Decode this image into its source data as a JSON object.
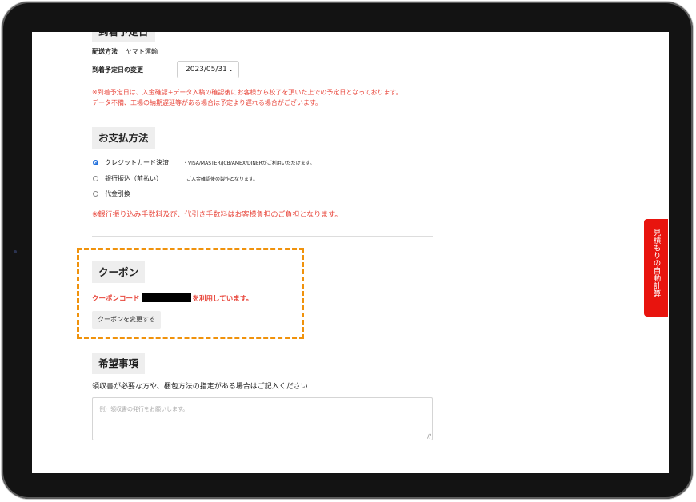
{
  "arrival": {
    "heading": "到着予定日",
    "shipping_label": "配送方法",
    "shipping_value": "ヤマト運輸",
    "date_label": "到着予定日の変更",
    "date_value": "2023/05/31",
    "note_line1": "※到着予定日は、入金確認+データ入稿の確認後にお客様から校了を頂いた上での予定日となっております。",
    "note_line2": "データ不備、工場の納期遅延等がある場合は予定より遅れる場合がございます。"
  },
  "payment": {
    "heading": "お支払方法",
    "options": [
      {
        "label": "クレジットカード決済",
        "note": "・VISA/MASTER/JCB/AMEX/DINERがご利用いただけます。",
        "checked": true
      },
      {
        "label": "銀行振込（前払い）",
        "note": "ご入金確認後の製作となります。",
        "checked": false
      },
      {
        "label": "代金引換",
        "note": "",
        "checked": false
      }
    ],
    "fee_note": "※銀行振り込み手数料及び、代引き手数料はお客様負担のご負担となります。"
  },
  "coupon": {
    "heading": "クーポン",
    "text_before": "クーポンコード",
    "text_after": "を利用しています。",
    "change_button": "クーポンを変更する"
  },
  "request": {
    "heading": "希望事項",
    "description": "領収書が必要な方や、梱包方法の指定がある場合はご記入ください",
    "placeholder": "例）領収書の発行をお願いします。"
  },
  "side_tab": {
    "label": "見積もりの自動計算"
  },
  "colors": {
    "accent_red": "#e8473c",
    "side_tab_red": "#e8140e",
    "highlight_orange": "#f0920c",
    "radio_blue": "#2673dd"
  }
}
